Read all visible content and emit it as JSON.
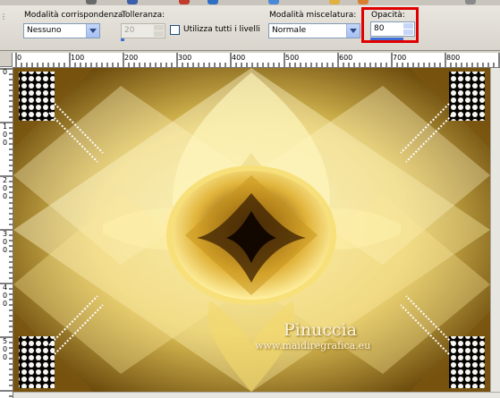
{
  "toolbar_strip": {
    "icons": [
      "brush-icon",
      "eraser-icon",
      "color-icon",
      "selection-icon",
      "layer-icon",
      "folder-icon",
      "save-icon",
      "effects-icon"
    ]
  },
  "options_bar": {
    "match_mode": {
      "label": "Modalità corrispondenza:",
      "value": "Nessuno"
    },
    "tolerance": {
      "label": "Tolleranza:",
      "value": "20"
    },
    "use_all_layers": {
      "label": "Utilizza tutti i livelli",
      "checked": false
    },
    "blend_mode": {
      "label": "Modalità miscelatura:",
      "value": "Normale"
    },
    "opacity": {
      "label": "Opacità:",
      "value": "80"
    }
  },
  "ruler": {
    "horizontal": [
      "0",
      "100",
      "200",
      "300",
      "400",
      "500",
      "600",
      "700",
      "800"
    ],
    "vertical": [
      "0",
      "1\n0\n0",
      "2\n0\n0",
      "3\n0\n0",
      "4\n0\n0",
      "5\n0\n0"
    ]
  },
  "watermark": {
    "name": "Pinuccia",
    "url": "www.maidiregrafica.eu"
  },
  "colors": {
    "gold_dark": "#6b4a0c",
    "gold_mid": "#c9a43a",
    "gold_light": "#f6eb9c",
    "highlight_red": "#e00000"
  }
}
